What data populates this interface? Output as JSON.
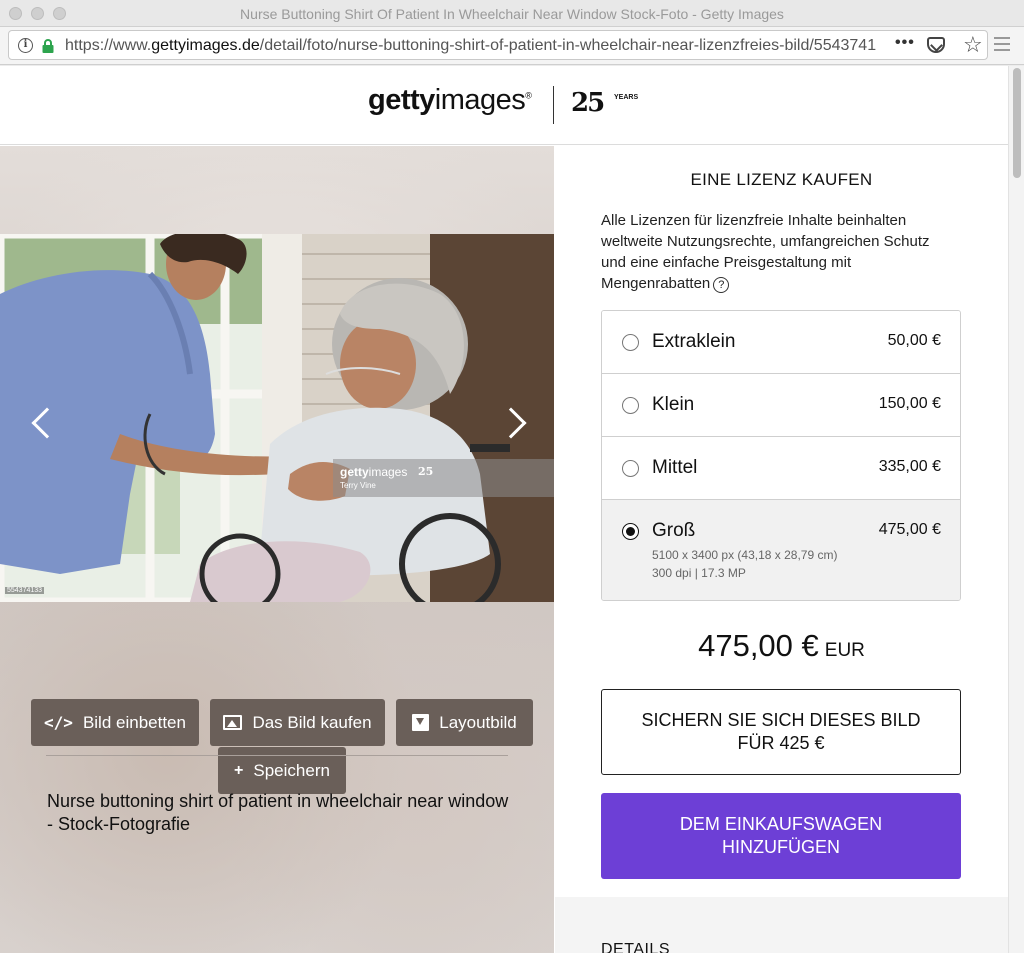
{
  "browser": {
    "window_title": "Nurse Buttoning Shirt Of Patient In Wheelchair Near Window Stock-Foto - Getty Images",
    "url_prefix": "https://www.",
    "url_domain": "gettyimages.de",
    "url_path": "/detail/foto/nurse-buttoning-shirt-of-patient-in-wheelchair-near-lizenzfreies-bild/5543741",
    "more_label": "•••",
    "star_glyph": "☆"
  },
  "header": {
    "logo_getty": "getty",
    "logo_images": "images",
    "logo_reg": "®",
    "anniversary_number": "25",
    "anniversary_word": "YEARS"
  },
  "photo": {
    "watermark_brand_a": "getty",
    "watermark_brand_b": "images",
    "watermark_25": "25",
    "watermark_credit": "Terry Vine",
    "image_id": "554374133"
  },
  "actions": {
    "embed_label": "Bild einbetten",
    "embed_icon": "</>",
    "buy_image_label": "Das Bild kaufen",
    "layout_label": "Layoutbild",
    "save_label": "Speichern",
    "save_icon": "+"
  },
  "caption": "Nurse buttoning shirt of patient in wheelchair near window - Stock-Fotografie",
  "license": {
    "title": "EINE LIZENZ KAUFEN",
    "description": "Alle Lizenzen für lizenzfreie Inhalte beinhalten weltweite Nutzungsrechte, umfangreichen Schutz und eine einfache Preisgestaltung mit Mengenrabatten",
    "help_icon": "?",
    "sizes": [
      {
        "name": "Extraklein",
        "price": "50,00 €",
        "selected": false
      },
      {
        "name": "Klein",
        "price": "150,00 €",
        "selected": false
      },
      {
        "name": "Mittel",
        "price": "335,00 €",
        "selected": false
      },
      {
        "name": "Groß",
        "price": "475,00 €",
        "selected": true,
        "detail_line1": "5100 x 3400 px (43,18 x 28,79 cm)",
        "detail_line2": "300 dpi | 17.3 MP"
      }
    ],
    "total_amount": "475,00 €",
    "total_currency": "EUR",
    "secure_button": "SICHERN SIE SICH DIESES BILD FÜR 425 €",
    "cart_button": "DEM EINKAUFSWAGEN HINZUFÜGEN",
    "details_title": "DETAILS"
  },
  "colors": {
    "purple_accent": "#6d3fd6",
    "dark_button": "#6a5f59",
    "lock_green": "#2da44e"
  }
}
